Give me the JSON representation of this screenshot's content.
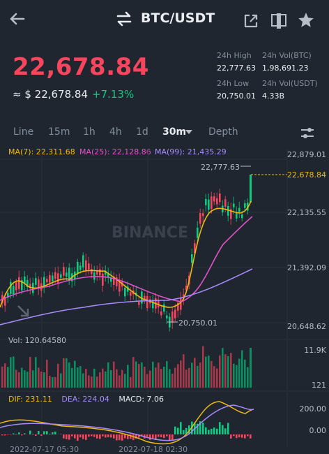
{
  "header": {
    "back_icon": "arrow-left-icon",
    "swap_icon": "swap-arrows-icon",
    "pair": "BTC/USDT",
    "share_icon": "external-link-icon",
    "book_icon": "split-panel-icon",
    "star_icon": "star-icon"
  },
  "price": {
    "last": "22,678.84",
    "fiat": "≈ $ 22,678.84",
    "change": "+7.13%",
    "color_down": "#f6465d",
    "color_up": "#0ecb81"
  },
  "stats": {
    "high_label": "24h High",
    "high_value": "22,777.63",
    "volbtc_label": "24h Vol(BTC)",
    "volbtc_value": "1,98,691.23",
    "low_label": "24h Low",
    "low_value": "20,750.01",
    "volusdt_label": "24h Vol(USDT)",
    "volusdt_value": "4.33B"
  },
  "tabs": {
    "line": "Line",
    "m15": "15m",
    "h1": "1h",
    "h4": "4h",
    "d1": "1d",
    "m30": "30m",
    "depth": "Depth",
    "settings_icon": "sliders-icon"
  },
  "ma": {
    "ma7": "MA(7): 22,311.68",
    "ma25": "MA(25): 22,128.86",
    "ma99": "MA(99): 21,435.29",
    "ma7_color": "#f0b90b",
    "ma25_color": "#e052c8",
    "ma99_color": "#a78bfa"
  },
  "price_axis": {
    "t1": "22,879.01",
    "t2": "22,135.55",
    "t3": "21,392.09",
    "t4": "20,648.62",
    "current_tag": "22,678.84"
  },
  "annotations": {
    "high_mark": "22,777.63",
    "low_mark": "20,750.01",
    "watermark": "BINANCE"
  },
  "volume": {
    "label": "Vol: 120.64580",
    "axis_top": "11.9K",
    "axis_bottom": "121"
  },
  "macd": {
    "dif": "DIF: 231.11",
    "dea": "DEA: 224.04",
    "macd": "MACD: 7.06",
    "axis_top": "200.00",
    "axis_bottom": "0.00",
    "dif_color": "#f0b90b",
    "dea_color": "#a78bfa",
    "macd_color": "#eaecef"
  },
  "time_axis": {
    "t1": "2022-07-17 05:30",
    "t2": "2022-07-18 02:30"
  }
}
